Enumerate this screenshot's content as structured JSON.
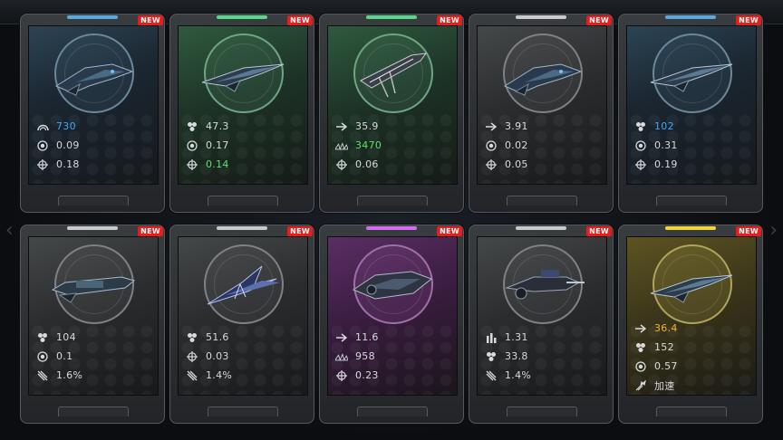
{
  "badge_label": "NEW",
  "cards": [
    {
      "theme": "blue",
      "ship": "assault-ship-icon",
      "stats": [
        {
          "icon": "armor-icon",
          "value": "730",
          "color": "blue"
        },
        {
          "icon": "fire-rate-icon",
          "value": "0.09",
          "color": ""
        },
        {
          "icon": "accuracy-icon",
          "value": "0.18",
          "color": ""
        }
      ]
    },
    {
      "theme": "green",
      "ship": "blade-ship-icon",
      "stats": [
        {
          "icon": "damage-icon",
          "value": "47.3",
          "color": ""
        },
        {
          "icon": "fire-rate-icon",
          "value": "0.17",
          "color": ""
        },
        {
          "icon": "accuracy-icon",
          "value": "0.14",
          "color": "green"
        }
      ]
    },
    {
      "theme": "green",
      "ship": "lance-ship-icon",
      "stats": [
        {
          "icon": "speed-icon",
          "value": "35.9",
          "color": ""
        },
        {
          "icon": "range-icon",
          "value": "3470",
          "color": "green"
        },
        {
          "icon": "accuracy-icon",
          "value": "0.06",
          "color": ""
        }
      ]
    },
    {
      "theme": "gray",
      "ship": "assault-ship-icon",
      "stats": [
        {
          "icon": "speed-icon",
          "value": "3.91",
          "color": ""
        },
        {
          "icon": "fire-rate-icon",
          "value": "0.02",
          "color": ""
        },
        {
          "icon": "accuracy-icon",
          "value": "0.05",
          "color": ""
        }
      ]
    },
    {
      "theme": "blue",
      "ship": "blade-ship-icon",
      "stats": [
        {
          "icon": "damage-icon",
          "value": "102",
          "color": "blue"
        },
        {
          "icon": "fire-rate-icon",
          "value": "0.31",
          "color": ""
        },
        {
          "icon": "accuracy-icon",
          "value": "0.19",
          "color": ""
        }
      ]
    },
    {
      "theme": "gray",
      "ship": "cruiser-ship-icon",
      "stats": [
        {
          "icon": "damage-icon",
          "value": "104",
          "color": ""
        },
        {
          "icon": "fire-rate-icon",
          "value": "0.1",
          "color": ""
        },
        {
          "icon": "crit-icon",
          "value": "1.6%",
          "color": ""
        }
      ]
    },
    {
      "theme": "gray",
      "ship": "interceptor-ship-icon",
      "stats": [
        {
          "icon": "damage-icon",
          "value": "51.6",
          "color": ""
        },
        {
          "icon": "accuracy-icon",
          "value": "0.03",
          "color": ""
        },
        {
          "icon": "crit-icon",
          "value": "1.4%",
          "color": ""
        }
      ]
    },
    {
      "theme": "purple",
      "ship": "heavy-ship-icon",
      "stats": [
        {
          "icon": "speed-icon",
          "value": "11.6",
          "color": ""
        },
        {
          "icon": "range-icon",
          "value": "958",
          "color": ""
        },
        {
          "icon": "accuracy-icon",
          "value": "0.23",
          "color": ""
        }
      ]
    },
    {
      "theme": "gray",
      "ship": "gunship-icon",
      "stats": [
        {
          "icon": "missile-icon",
          "value": "1.31",
          "color": ""
        },
        {
          "icon": "damage-icon",
          "value": "33.8",
          "color": ""
        },
        {
          "icon": "crit-icon",
          "value": "1.4%",
          "color": ""
        }
      ]
    },
    {
      "theme": "gold",
      "ship": "blade-ship-icon",
      "stats": [
        {
          "icon": "speed-icon",
          "value": "36.4",
          "color": "gold"
        },
        {
          "icon": "damage-icon",
          "value": "152",
          "color": ""
        },
        {
          "icon": "fire-rate-icon",
          "value": "0.57",
          "color": ""
        },
        {
          "icon": "boost-icon",
          "value": "加速",
          "color": ""
        }
      ]
    }
  ],
  "colors": {
    "blue": "#3fa7ff",
    "green": "#5fe06a",
    "gold": "#f3b42a",
    "badge": "#e51d1d"
  }
}
